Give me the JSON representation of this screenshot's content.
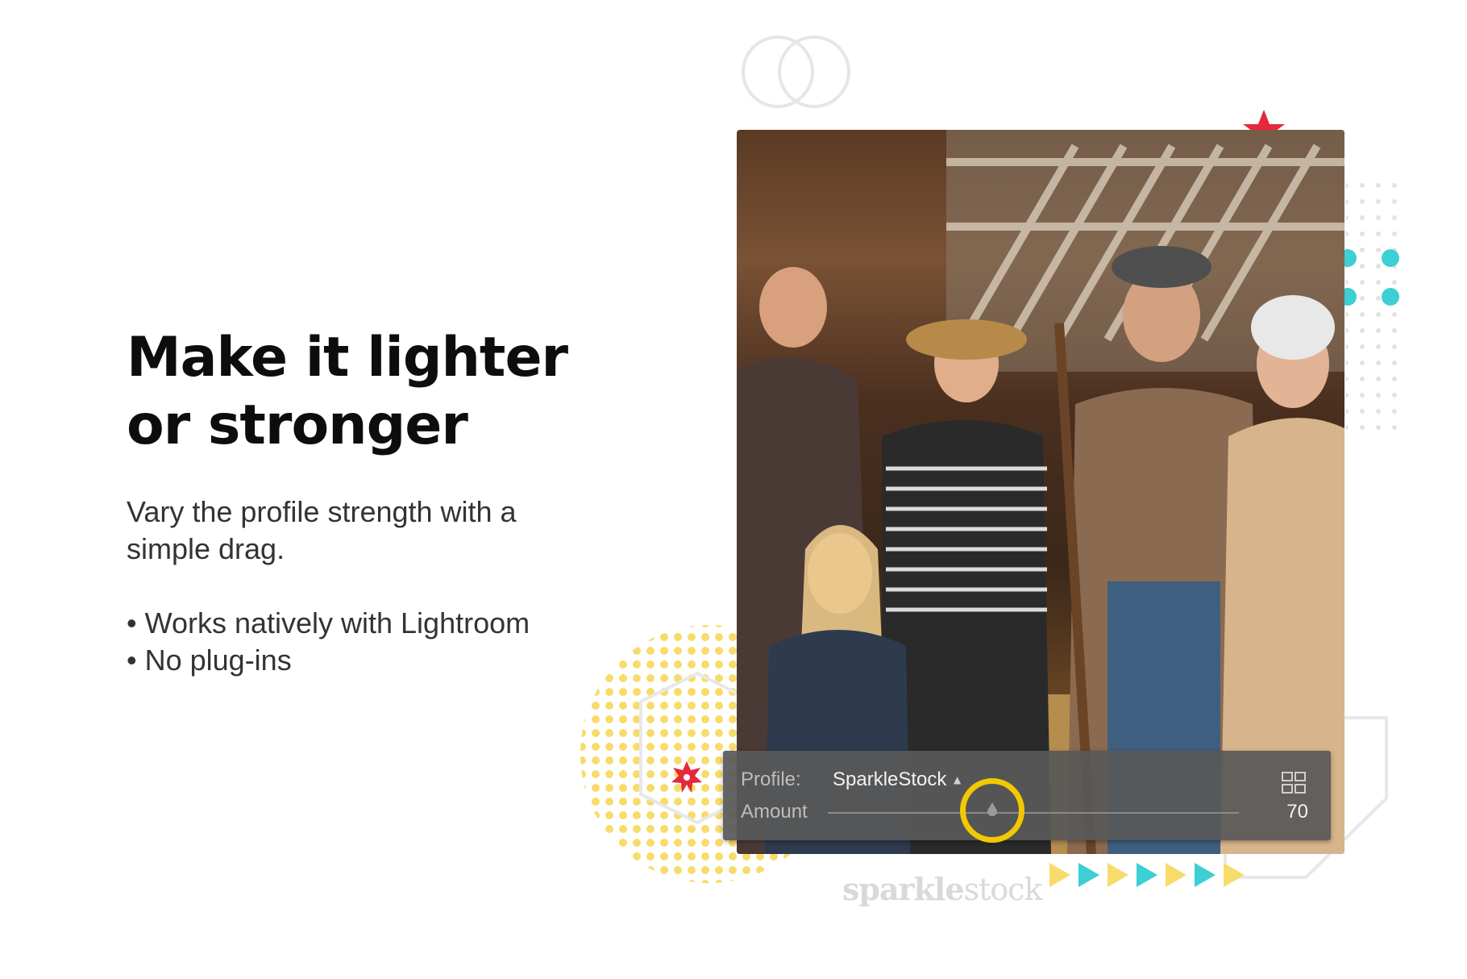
{
  "headline": {
    "line1": "Make it lighter",
    "line2": "or stronger"
  },
  "description": "Vary the profile strength with a simple drag.",
  "bullets": [
    "Works natively with Lightroom",
    "No plug-ins"
  ],
  "panel": {
    "profile_label": "Profile:",
    "profile_value": "SparkleStock",
    "amount_label": "Amount",
    "amount_value": "70",
    "slider_level": 0.4,
    "grid_icon": "grid-view-icon"
  },
  "watermark": {
    "part1": "sparkle",
    "part2": "stock"
  },
  "colors": {
    "accent_yellow": "#f2c800",
    "accent_teal": "#3ccfd3",
    "accent_red": "#e5283a",
    "panel_bg": "#595959"
  }
}
